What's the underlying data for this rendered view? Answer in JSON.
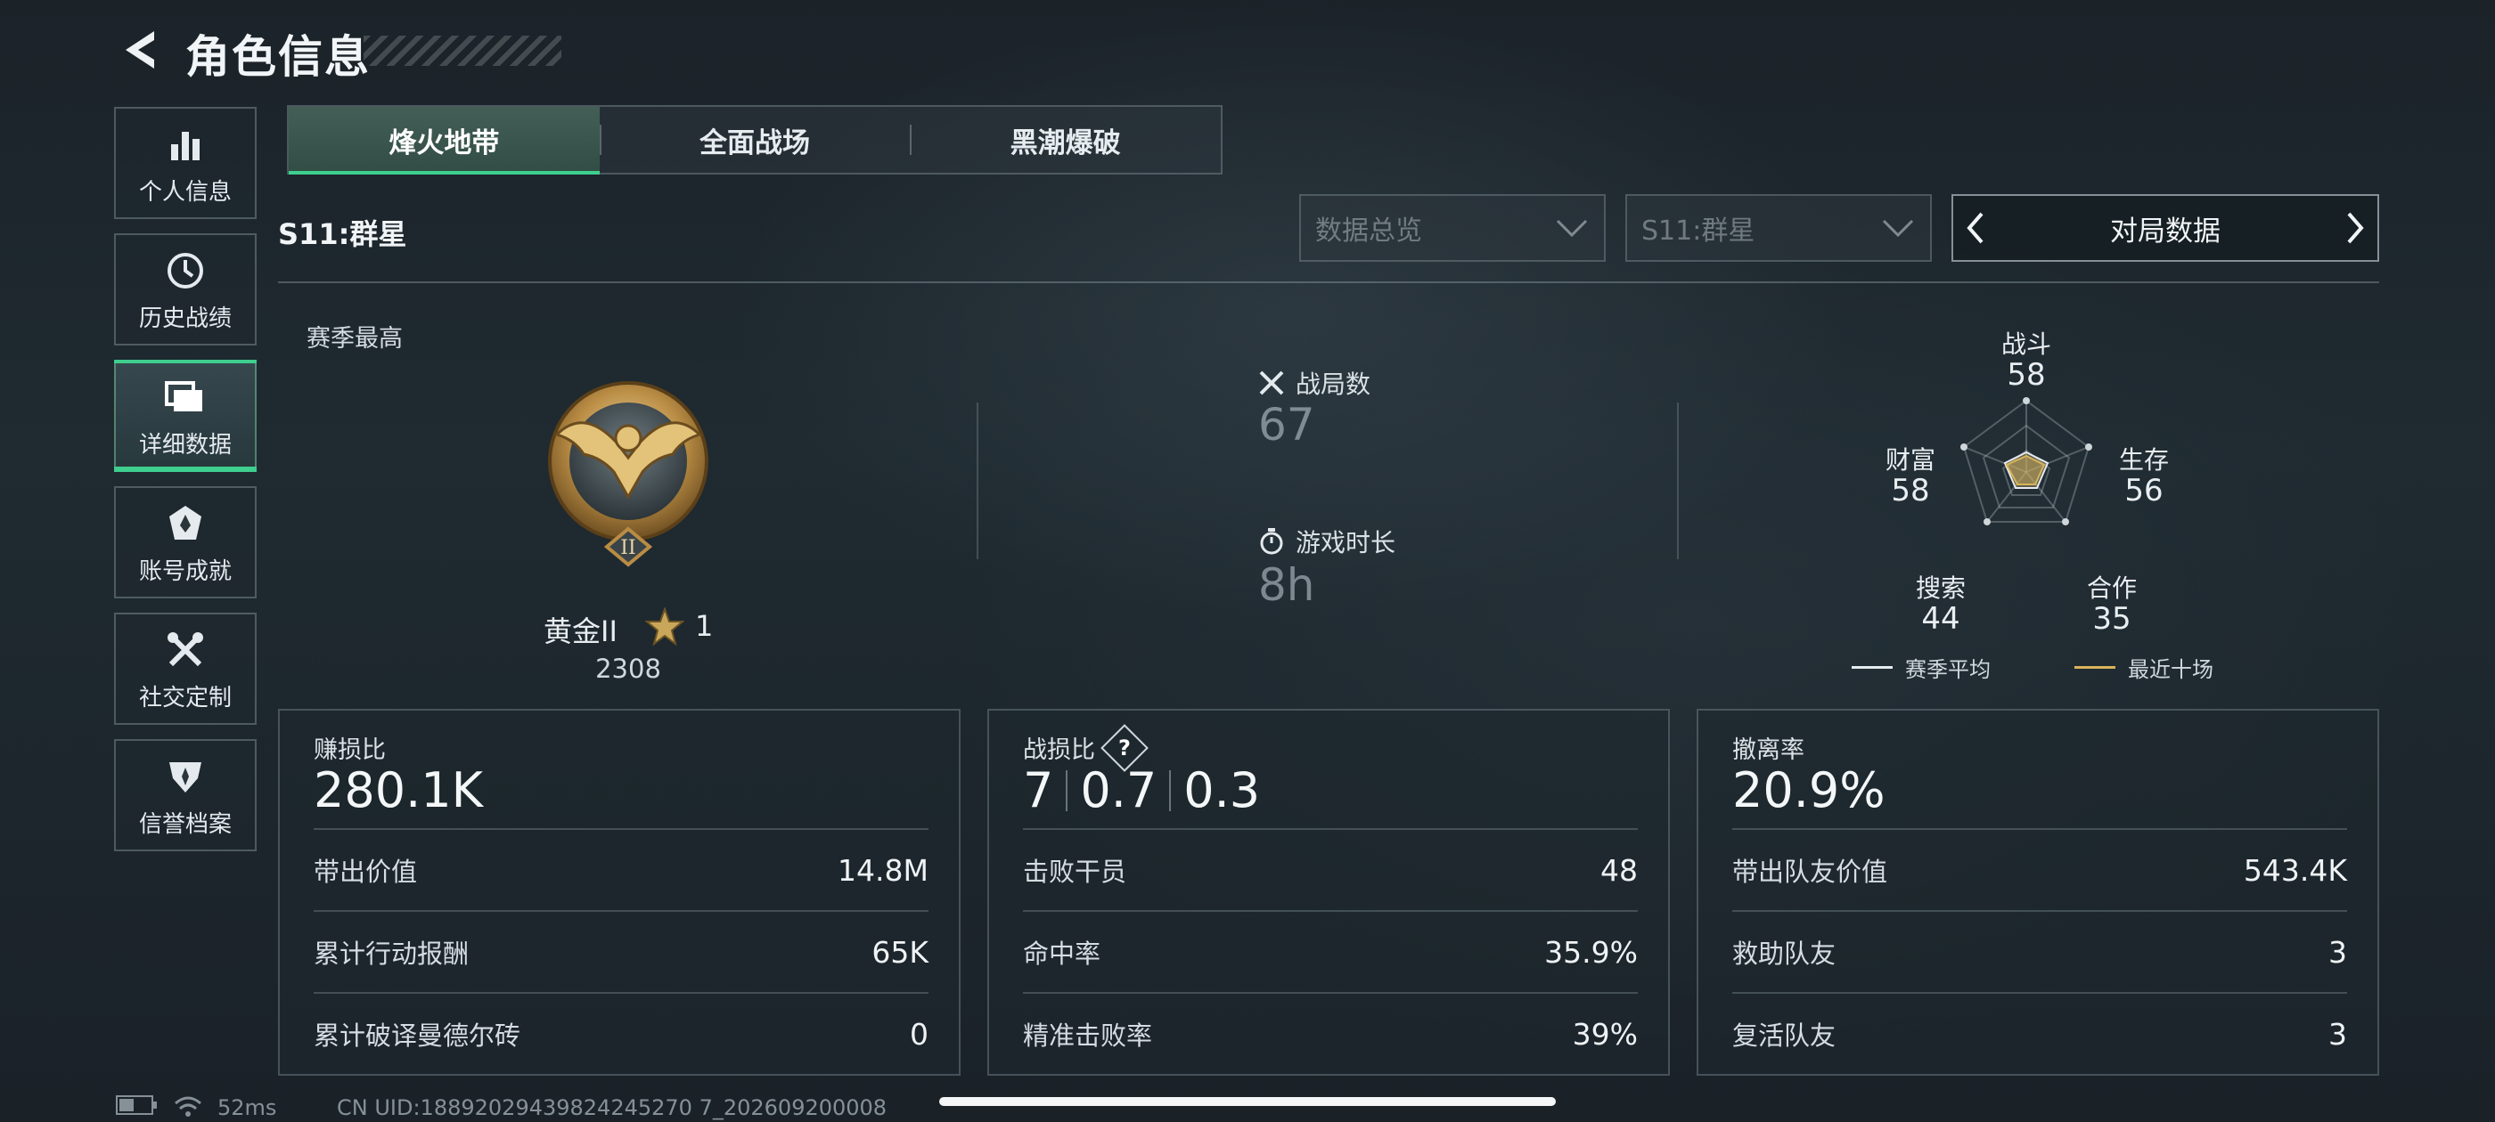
{
  "header": {
    "title": "角色信息"
  },
  "sidebar": {
    "items": [
      {
        "label": "个人信息",
        "icon": "bar-chart-icon"
      },
      {
        "label": "历史战绩",
        "icon": "clock-icon"
      },
      {
        "label": "详细数据",
        "icon": "folders-icon",
        "active": true
      },
      {
        "label": "账号成就",
        "icon": "badge-icon"
      },
      {
        "label": "社交定制",
        "icon": "tools-icon"
      },
      {
        "label": "信誉档案",
        "icon": "shield-icon"
      }
    ]
  },
  "tabs": [
    {
      "label": "烽火地带",
      "active": true
    },
    {
      "label": "全面战场"
    },
    {
      "label": "黑潮爆破"
    }
  ],
  "season": {
    "label": "S11:群星"
  },
  "filters": {
    "data_overview": "数据总览",
    "season_select": "S11:群星",
    "stat_switch": "对局数据"
  },
  "rank": {
    "best_label": "赛季最高",
    "name": "黄金II",
    "stars": "1",
    "score": "2308",
    "medal_roman": "II"
  },
  "match_stats": {
    "matches_label": "战局数",
    "matches_value": "67",
    "playtime_label": "游戏时长",
    "playtime_value": "8h"
  },
  "radar": {
    "axes": [
      {
        "label": "战斗",
        "value": "58"
      },
      {
        "label": "生存",
        "value": "56"
      },
      {
        "label": "合作",
        "value": "35"
      },
      {
        "label": "搜索",
        "value": "44"
      },
      {
        "label": "财富",
        "value": "58"
      }
    ],
    "legend_season": "赛季平均",
    "legend_recent": "最近十场",
    "colors": {
      "season": "#e6ebee",
      "recent": "#d8b45a"
    }
  },
  "panels": {
    "profit": {
      "title": "赚损比",
      "big": "280.1K",
      "rows": [
        {
          "k": "带出价值",
          "v": "14.8M"
        },
        {
          "k": "累计行动报酬",
          "v": "65K"
        },
        {
          "k": "累计破译曼德尔砖",
          "v": "0"
        }
      ]
    },
    "combat": {
      "title": "战损比",
      "big_a": "7",
      "big_b": "0.7",
      "big_c": "0.3",
      "help": "?",
      "rows": [
        {
          "k": "击败干员",
          "v": "48"
        },
        {
          "k": "命中率",
          "v": "35.9%"
        },
        {
          "k": "精准击败率",
          "v": "39%"
        }
      ]
    },
    "extract": {
      "title": "撤离率",
      "big": "20.9%",
      "rows": [
        {
          "k": "带出队友价值",
          "v": "543.4K"
        },
        {
          "k": "救助队友",
          "v": "3"
        },
        {
          "k": "复活队友",
          "v": "3"
        }
      ]
    }
  },
  "footer": {
    "ping": "52ms",
    "uid": "CN UID:18892029439824245270 7_202609200008"
  },
  "accent": "#3ecf8e"
}
